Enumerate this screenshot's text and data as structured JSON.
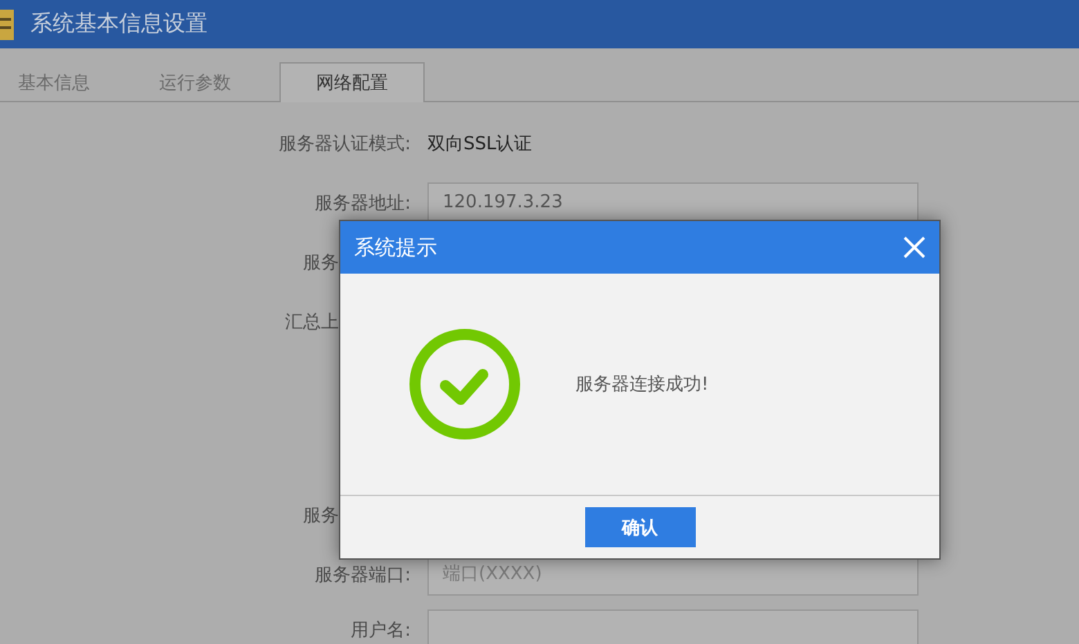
{
  "window": {
    "title": "系统基本信息设置"
  },
  "tabs": [
    {
      "label": "基本信息",
      "selected": false
    },
    {
      "label": "运行参数",
      "selected": false
    },
    {
      "label": "网络配置",
      "selected": true
    }
  ],
  "form": [
    {
      "kind": "text",
      "label": "服务器认证模式:",
      "value": "双向SSL认证"
    },
    {
      "kind": "field",
      "label": "服务器地址:",
      "value": "120.197.3.23"
    },
    {
      "kind": "cut",
      "label": "服务"
    },
    {
      "kind": "cut",
      "label": "汇总上"
    },
    {
      "kind": "cut",
      "label": "服务"
    },
    {
      "kind": "field",
      "label": "服务器端口:",
      "placeholder": "端口(XXXX)"
    },
    {
      "kind": "field",
      "label": "用户名:"
    }
  ],
  "dialog": {
    "title": "系统提示",
    "message": "服务器连接成功!",
    "button": "确认"
  }
}
